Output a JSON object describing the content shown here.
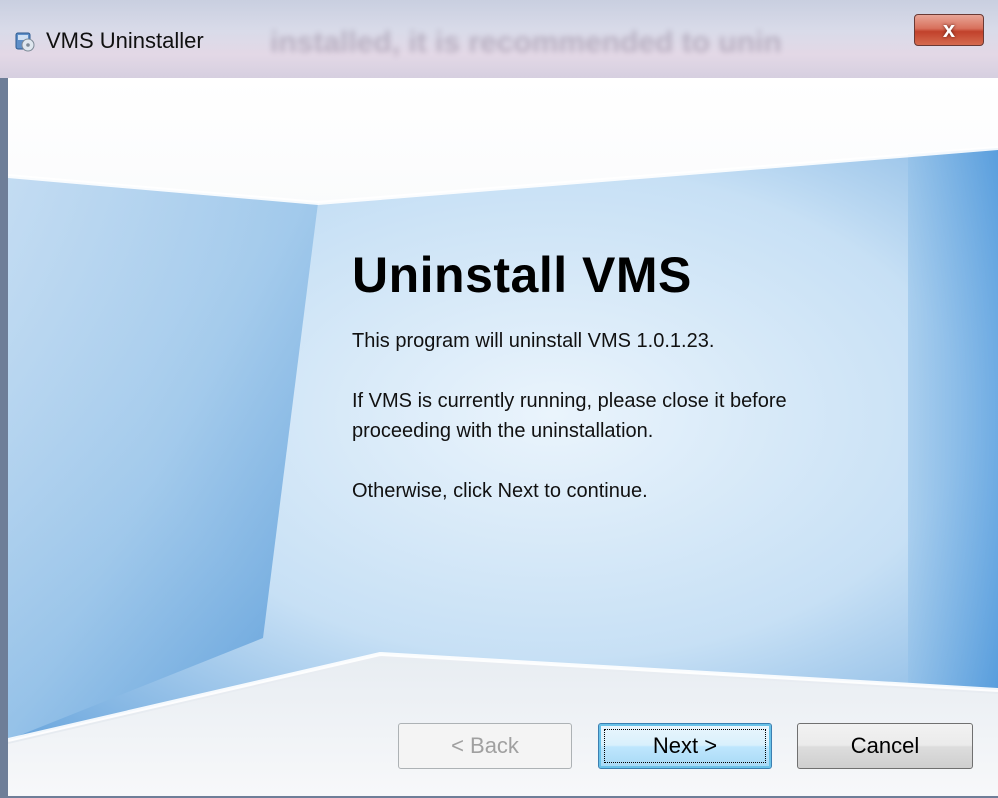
{
  "window": {
    "title": "VMS Uninstaller",
    "background_title_blurred": "installed, it is recommended to unin",
    "close_symbol": "x"
  },
  "content": {
    "heading": "Uninstall VMS",
    "line1": "This program will uninstall VMS 1.0.1.23.",
    "line2a": "If VMS is currently running, please close it before",
    "line2b": "proceeding with the uninstallation.",
    "line3": "Otherwise, click Next to continue."
  },
  "buttons": {
    "back": {
      "label": "< Back",
      "enabled": false
    },
    "next": {
      "label": "Next >",
      "enabled": true,
      "default": true
    },
    "cancel": {
      "label": "Cancel",
      "enabled": true
    }
  },
  "colors": {
    "accent_blue": "#2f86d6",
    "close_red": "#c1412b"
  },
  "icons": {
    "app": "installer-disk-icon",
    "close": "close-icon"
  }
}
